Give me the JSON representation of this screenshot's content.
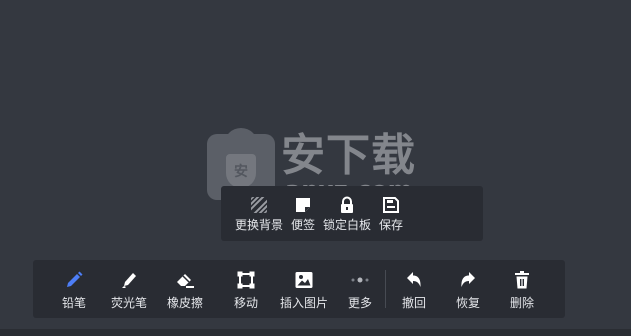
{
  "colors": {
    "background": "#343840",
    "panel": "#292c33",
    "text": "#e4e6ea",
    "icon": "#ffffff",
    "active_icon": "#4d7ef7"
  },
  "watermark": {
    "title": "安下载",
    "domain": "anxz.com",
    "shield_char": "安"
  },
  "secondary_menu": {
    "items": [
      {
        "label": "更换背景",
        "icon": "hatch-background-icon"
      },
      {
        "label": "便签",
        "icon": "sticky-note-icon"
      },
      {
        "label": "锁定白板",
        "icon": "lock-icon"
      },
      {
        "label": "保存",
        "icon": "save-icon"
      }
    ]
  },
  "toolbar": {
    "items": [
      {
        "label": "铅笔",
        "icon": "pencil-icon",
        "active": true
      },
      {
        "label": "荧光笔",
        "icon": "highlighter-icon"
      },
      {
        "label": "橡皮擦",
        "icon": "eraser-icon"
      },
      {
        "label": "移动",
        "icon": "move-icon"
      },
      {
        "label": "插入图片",
        "icon": "image-icon"
      },
      {
        "label": "更多",
        "icon": "more-icon"
      },
      {
        "label": "撤回",
        "icon": "undo-icon"
      },
      {
        "label": "恢复",
        "icon": "redo-icon"
      },
      {
        "label": "删除",
        "icon": "trash-icon"
      }
    ]
  }
}
